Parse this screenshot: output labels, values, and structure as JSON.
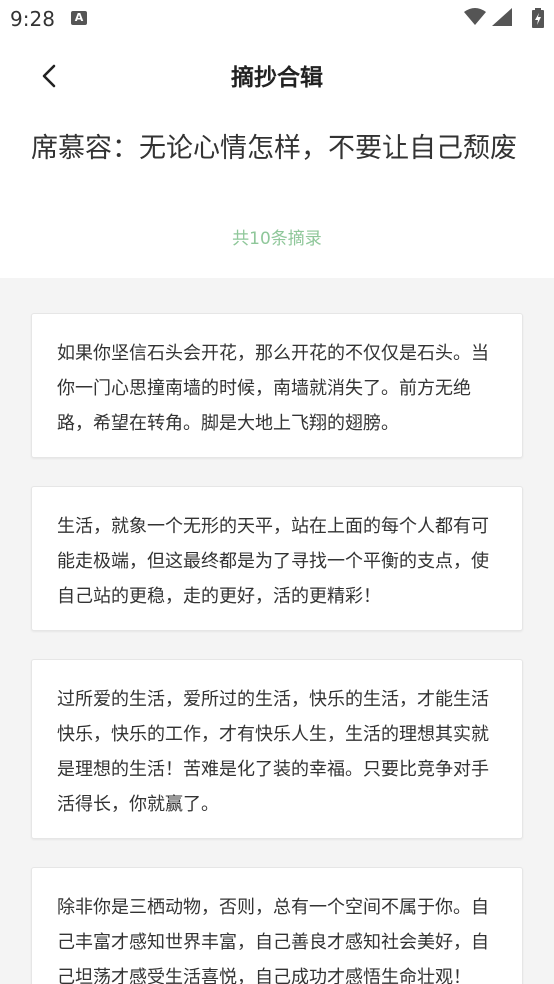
{
  "status_bar": {
    "time": "9:28",
    "notification_icon": "A"
  },
  "header": {
    "title": "摘抄合辑",
    "back_icon": "chevron-left-icon"
  },
  "collection": {
    "title": "席慕容：无论心情怎样，不要让自己颓废",
    "count_label": "共10条摘录"
  },
  "quotes": [
    "如果你坚信石头会开花，那么开花的不仅仅是石头。当你一门心思撞南墙的时候，南墙就消失了。前方无绝路，希望在转角。脚是大地上飞翔的翅膀。",
    "生活，就象一个无形的天平，站在上面的每个人都有可能走极端，但这最终都是为了寻找一个平衡的支点，使自己站的更稳，走的更好，活的更精彩！",
    "过所爱的生活，爱所过的生活，快乐的生活，才能生活快乐，快乐的工作，才有快乐人生，生活的理想其实就是理想的生活！苦难是化了装的幸福。只要比竞争对手活得长，你就赢了。",
    "除非你是三栖动物，否则，总有一个空间不属于你。自己丰富才感知世界丰富，自己善良才感知社会美好，自己坦荡才感受生活喜悦，自己成功才感悟生命壮观！"
  ],
  "colors": {
    "accent_green": "#8fc79a",
    "background": "#f4f4f4",
    "card": "#ffffff"
  }
}
